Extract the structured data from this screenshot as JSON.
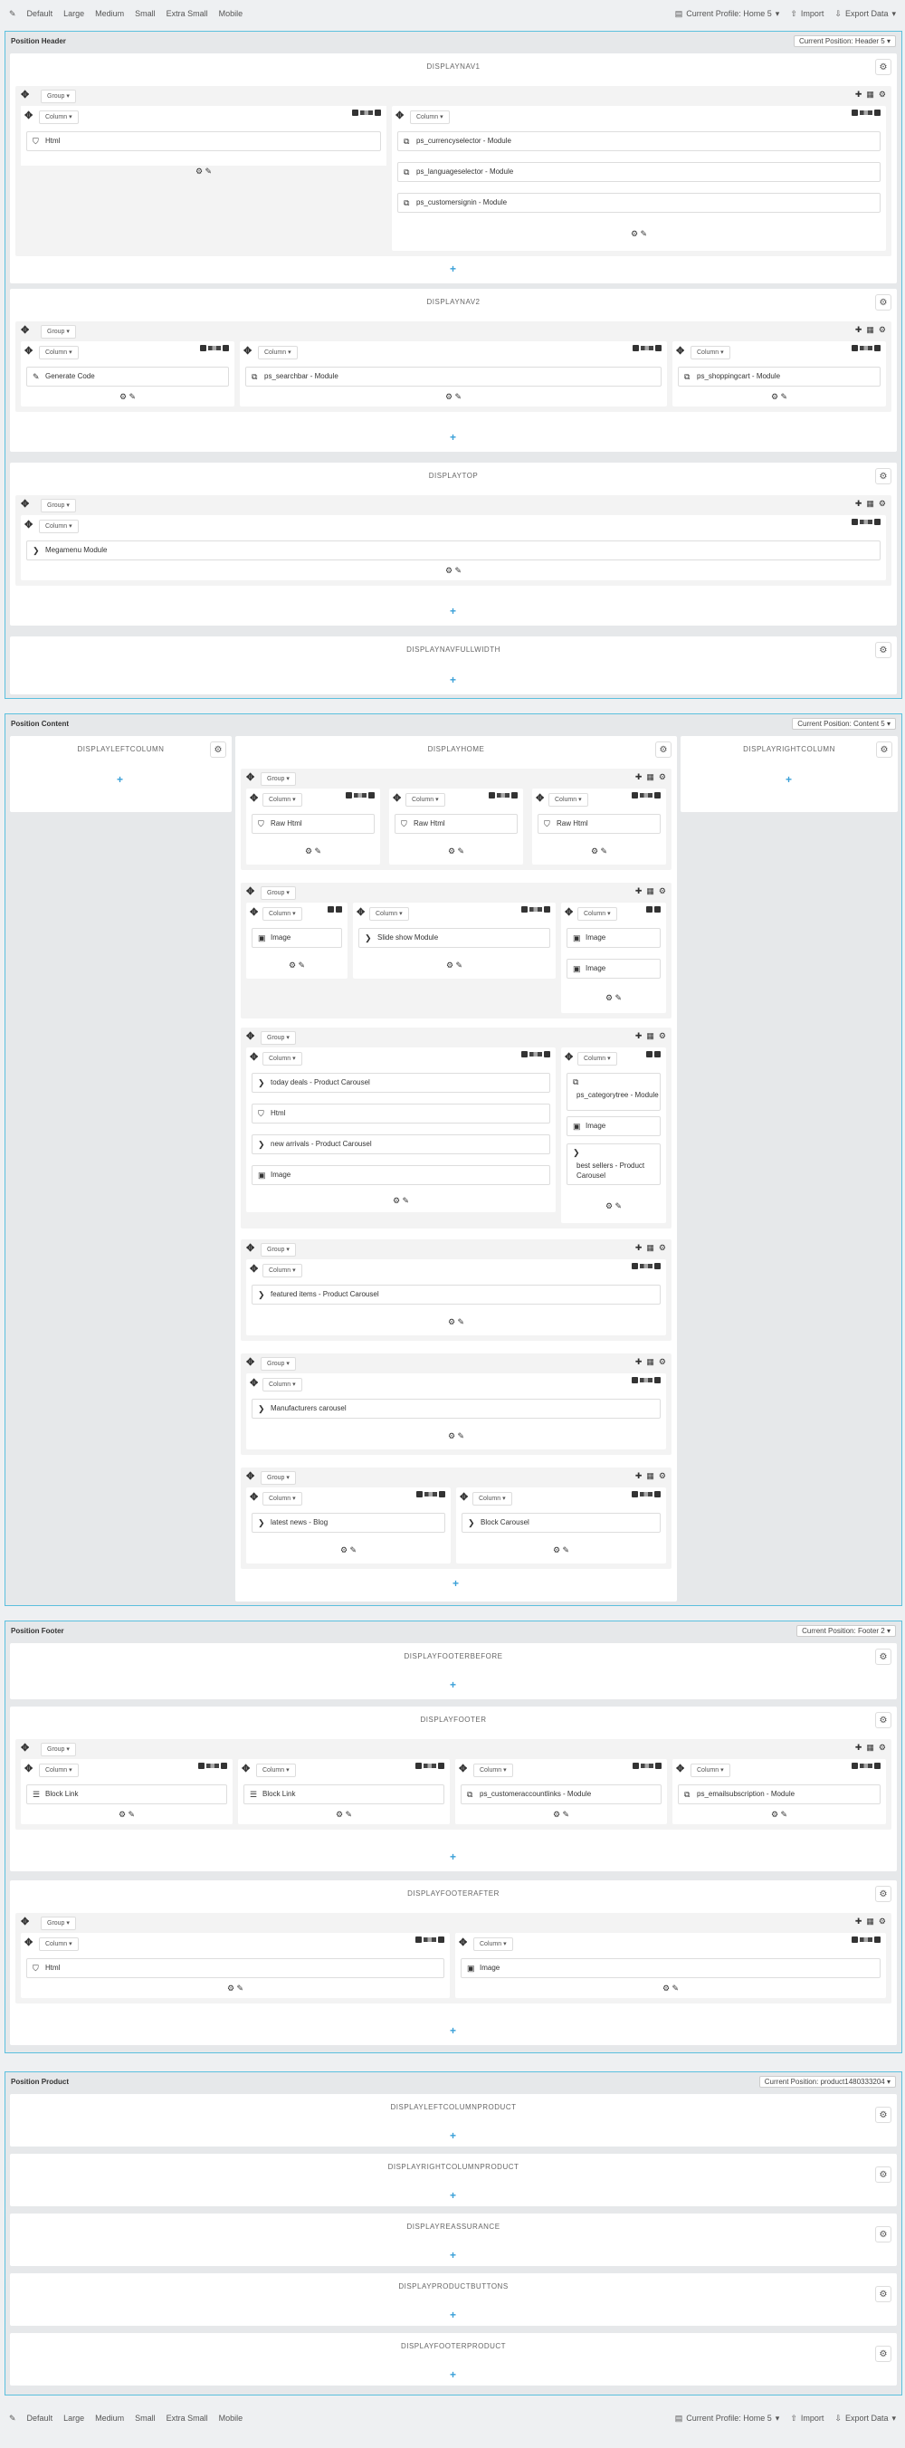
{
  "toolbar": {
    "items": [
      "Default",
      "Large",
      "Medium",
      "Small",
      "Extra Small",
      "Mobile"
    ],
    "profile": "Current Profile: Home 5",
    "import": "Import",
    "export": "Export Data"
  },
  "toolbar_bottom": {
    "items": [
      "Default",
      "Large",
      "Medium",
      "Small",
      "Extra Small",
      "Mobile"
    ],
    "profile": "Current Profile: Home 5",
    "import": "Import",
    "export": "Export Data"
  },
  "labels": {
    "group": "Group",
    "column": "Column"
  },
  "header": {
    "title": "Position Header",
    "current": "Current Position: Header 5",
    "hooks": [
      "DISPLAYNAV1",
      "DISPLAYNAV2",
      "DISPLAYTOP",
      "DISPLAYNAVFULLWIDTH"
    ]
  },
  "content": {
    "title": "Position Content",
    "current": "Current Position: Content 5",
    "hooks": [
      "DISPLAYLEFTCOLUMN",
      "DISPLAYHOME",
      "DISPLAYRIGHTCOLUMN"
    ]
  },
  "footer": {
    "title": "Position Footer",
    "current": "Current Position: Footer 2",
    "hooks": [
      "DISPLAYFOOTERBEFORE",
      "DISPLAYFOOTER",
      "DISPLAYFOOTERAFTER"
    ]
  },
  "product": {
    "title": "Position Product",
    "current": "Current Position: product1480333204",
    "hooks": [
      "DISPLAYLEFTCOLUMNPRODUCT",
      "DISPLAYRIGHTCOLUMNPRODUCT",
      "DISPLAYREASSURANCE",
      "DISPLAYPRODUCTBUTTONS",
      "DISPLAYFOOTERPRODUCT"
    ]
  },
  "modules": {
    "nav1_html": "Html",
    "nav1_currency": "ps_currencyselector - Module",
    "nav1_language": "ps_languageselector - Module",
    "nav1_signin": "ps_customersignin - Module",
    "nav2_code": "Generate Code",
    "nav2_search": "ps_searchbar - Module",
    "nav2_cart": "ps_shoppingcart - Module",
    "top_mega": "Megamenu Module",
    "g1_raw1": "Raw Html",
    "g1_raw2": "Raw Html",
    "g1_raw3": "Raw Html",
    "g2_image1": "Image",
    "g2_slide": "Slide show Module",
    "g2_image2": "Image",
    "g2_image3": "Image",
    "g3_today": "today deals - Product Carousel",
    "g3_html": "Html",
    "g3_new": "new arrivals - Product Carousel",
    "g3_image": "Image",
    "g3_cattree": "ps_categorytree - Module",
    "g3_image2": "Image",
    "g3_best": "best sellers - Product Carousel",
    "g4_featured": "featured items - Product Carousel",
    "g5_manuf": "Manufacturers carousel",
    "g6_blog": "latest news - Blog",
    "g6_block": "Block Carousel",
    "f_link1": "Block Link",
    "f_link2": "Block Link",
    "f_account": "ps_customeraccountlinks - Module",
    "f_email": "ps_emailsubscription - Module",
    "fa_html": "Html",
    "fa_image": "Image"
  },
  "icons": {
    "accent": "#3aa0d8",
    "border": "#5bc0de"
  }
}
